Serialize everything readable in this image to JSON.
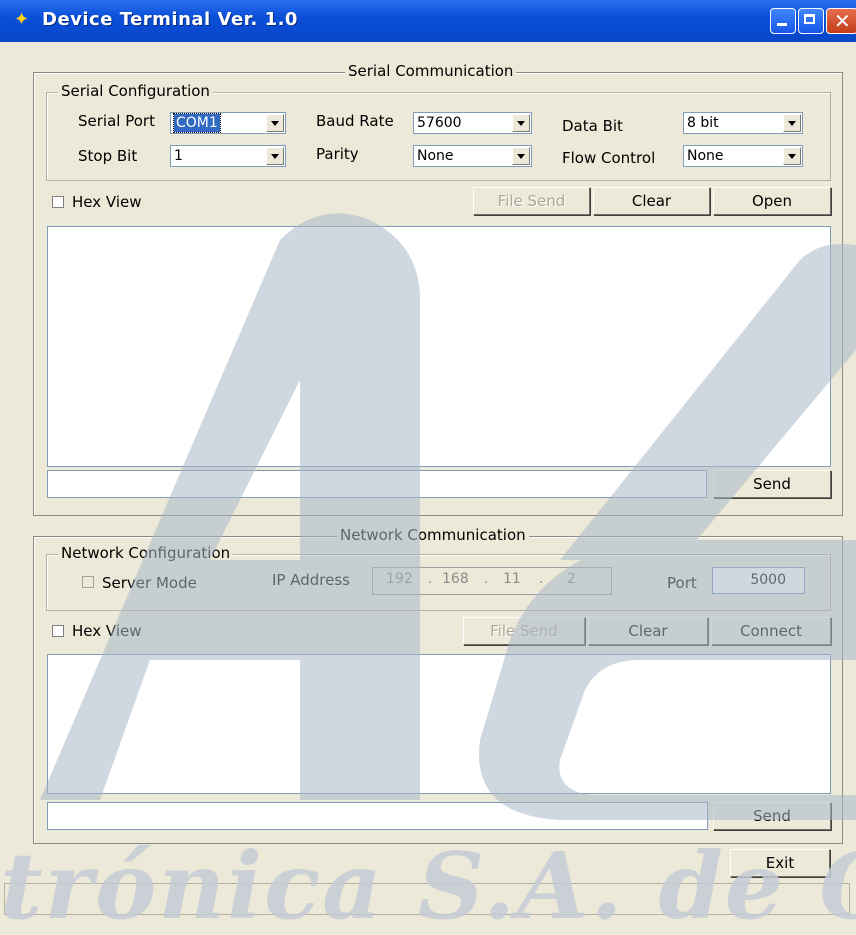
{
  "window": {
    "title": "Device Terminal Ver. 1.0"
  },
  "serial": {
    "group_title": "Serial Communication",
    "config_title": "Serial Configuration",
    "serial_port_label": "Serial Port",
    "serial_port_value": "COM1",
    "baud_rate_label": "Baud Rate",
    "baud_rate_value": "57600",
    "data_bit_label": "Data Bit",
    "data_bit_value": "8 bit",
    "stop_bit_label": "Stop Bit",
    "stop_bit_value": "1",
    "parity_label": "Parity",
    "parity_value": "None",
    "flow_control_label": "Flow Control",
    "flow_control_value": "None",
    "hex_view_label": "Hex View",
    "file_send_label": "File Send",
    "clear_label": "Clear",
    "open_label": "Open",
    "send_label": "Send",
    "input_value": ""
  },
  "network": {
    "group_title": "Network Communication",
    "config_title": "Network Configuration",
    "server_mode_label": "Server Mode",
    "ip_address_label": "IP Address",
    "ip": [
      "192",
      "168",
      "11",
      "2"
    ],
    "port_label": "Port",
    "port_value": "5000",
    "hex_view_label": "Hex View",
    "file_send_label": "File Send",
    "clear_label": "Clear",
    "connect_label": "Connect",
    "send_label": "Send",
    "input_value": ""
  },
  "footer": {
    "exit_label": "Exit"
  },
  "watermark": {
    "text": "trónica S.A. de C"
  },
  "colors": {
    "titlebar": "#0a4fd8",
    "face": "#ece9d8",
    "watermark": "#c5ccd6"
  }
}
